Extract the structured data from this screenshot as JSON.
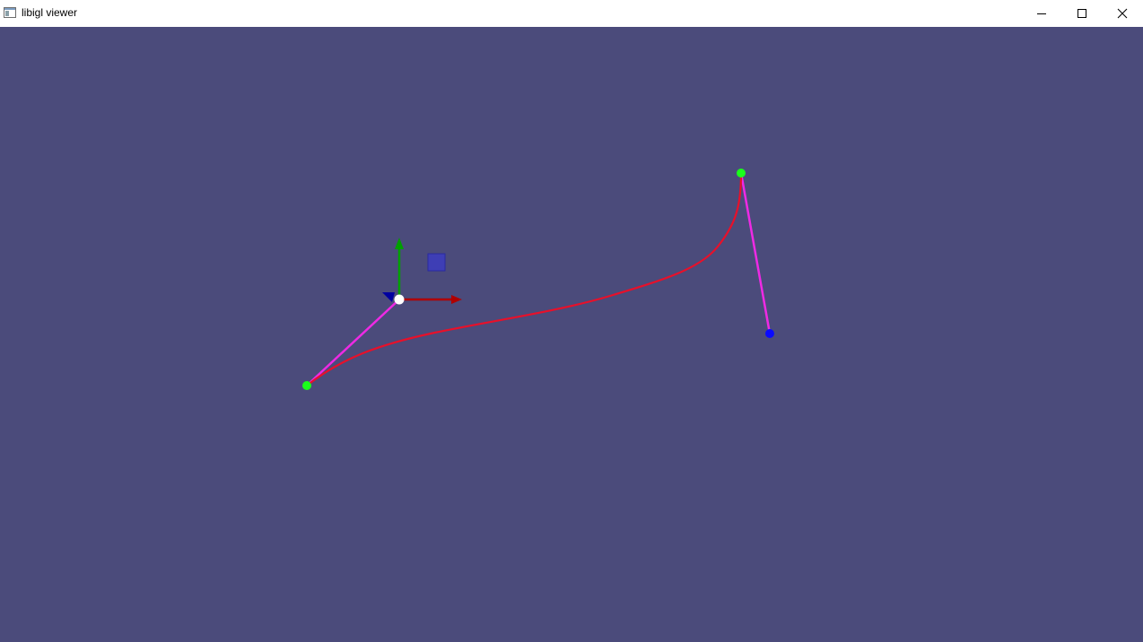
{
  "window": {
    "title": "libigl viewer",
    "icon": "app-window-icon",
    "controls": {
      "minimize_icon": "minimize-icon",
      "maximize_icon": "maximize-icon",
      "close_icon": "close-icon"
    }
  },
  "viewport": {
    "background_color": "#4b4b7b",
    "curve_color": "#e8102a",
    "handle_line_color": "#ee2ae4",
    "control_point_color": "#1aff1a",
    "selected_point_color": "#ffffff",
    "end_handle_color": "#0a0aff",
    "gizmo": {
      "x_axis_color": "#b00000",
      "y_axis_color": "#00a000",
      "z_axis_color": "#0000a0",
      "plane_handle_color": "#3a3ac8"
    }
  }
}
